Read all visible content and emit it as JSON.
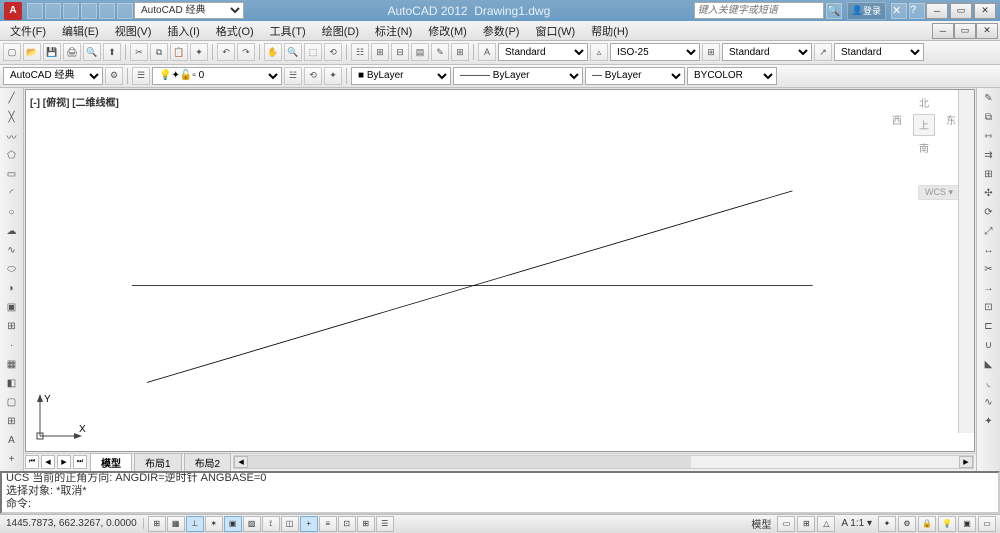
{
  "title": {
    "app": "AutoCAD 2012",
    "file": "Drawing1.dwg",
    "workspace": "AutoCAD 经典",
    "search_placeholder": "键入关键字或短语",
    "login": "登录"
  },
  "menubar": [
    "文件(F)",
    "编辑(E)",
    "视图(V)",
    "插入(I)",
    "格式(O)",
    "工具(T)",
    "绘图(D)",
    "标注(N)",
    "修改(M)",
    "参数(P)",
    "窗口(W)",
    "帮助(H)"
  ],
  "toolbar1": {
    "text_style": "Standard",
    "dim_style": "ISO-25",
    "table_style": "Standard",
    "mleader_style": "Standard"
  },
  "toolbar2": {
    "layer_select": "AutoCAD 经典",
    "layer_state": "0",
    "color": "ByLayer",
    "linetype": "ByLayer",
    "lineweight": "ByLayer",
    "plot_style": "BYCOLOR"
  },
  "canvas": {
    "view_label": "[-] [俯视] [二维线框]",
    "viewcube": {
      "north": "北",
      "south": "南",
      "east": "东",
      "west": "西",
      "top": "上"
    },
    "wcs": "WCS",
    "ucs_x": "X",
    "ucs_y": "Y"
  },
  "tabs": {
    "model": "模型",
    "layout1": "布局1",
    "layout2": "布局2"
  },
  "command": {
    "line1": "UCS 当前的正角方向:  ANGDIR=逆时针  ANGBASE=0",
    "line2": "选择对象: *取消*",
    "prompt": "命令:"
  },
  "status": {
    "coords": "1445.7873, 662.3267, 0.0000",
    "model_label": "模型",
    "scale": "1:1",
    "annotation": "A"
  }
}
